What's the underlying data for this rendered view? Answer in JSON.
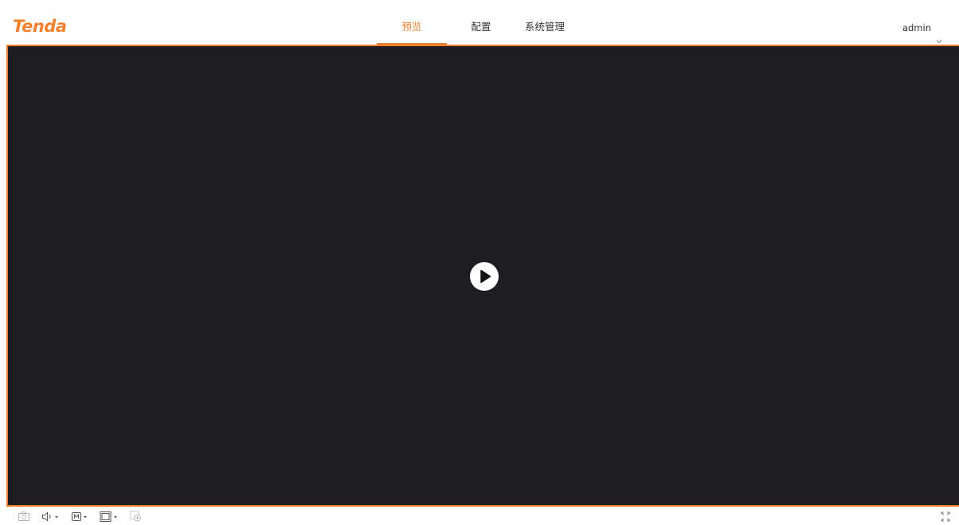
{
  "header": {
    "logo_text": "Tenda",
    "nav": [
      {
        "label": "预览",
        "active": true
      },
      {
        "label": "配置",
        "active": false
      },
      {
        "label": "系统管理",
        "active": false
      }
    ],
    "user": {
      "name": "admin"
    }
  },
  "colors": {
    "accent": "#f2812f",
    "video_bg": "#1d1e21",
    "icon_gray": "#b3b3b3"
  },
  "video": {
    "play_icon": "play-icon"
  },
  "toolbar": {
    "icons": [
      "camera-icon",
      "volume-icon",
      "stream-mode-icon",
      "window-layout-icon",
      "digital-zoom-icon",
      "fullscreen-icon"
    ]
  }
}
